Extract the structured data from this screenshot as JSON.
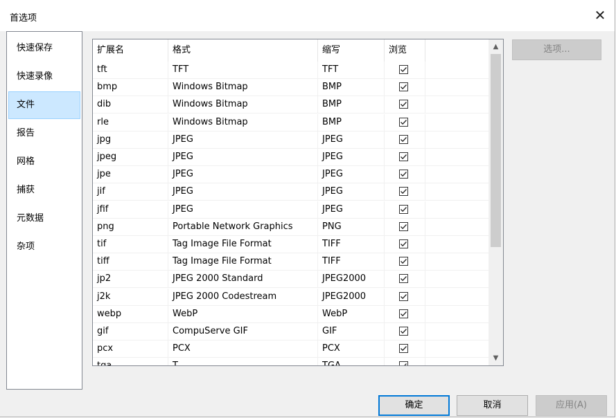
{
  "window": {
    "title": "首选项",
    "close_glyph": "✕"
  },
  "sidebar": {
    "items": [
      {
        "label": "快速保存"
      },
      {
        "label": "快速录像"
      },
      {
        "label": "文件",
        "selected": true
      },
      {
        "label": "报告"
      },
      {
        "label": "网格"
      },
      {
        "label": "捕获"
      },
      {
        "label": "元数据"
      },
      {
        "label": "杂项"
      }
    ]
  },
  "table": {
    "headers": {
      "ext": "扩展名",
      "format": "格式",
      "abbr": "缩写",
      "view": "浏览"
    },
    "rows": [
      {
        "ext": "tft",
        "format": "TFT",
        "abbr": "TFT",
        "checked": true
      },
      {
        "ext": "bmp",
        "format": "Windows Bitmap",
        "abbr": "BMP",
        "checked": true
      },
      {
        "ext": "dib",
        "format": "Windows Bitmap",
        "abbr": "BMP",
        "checked": true
      },
      {
        "ext": "rle",
        "format": "Windows Bitmap",
        "abbr": "BMP",
        "checked": true
      },
      {
        "ext": "jpg",
        "format": "JPEG",
        "abbr": "JPEG",
        "checked": true
      },
      {
        "ext": "jpeg",
        "format": "JPEG",
        "abbr": "JPEG",
        "checked": true
      },
      {
        "ext": "jpe",
        "format": "JPEG",
        "abbr": "JPEG",
        "checked": true
      },
      {
        "ext": "jif",
        "format": "JPEG",
        "abbr": "JPEG",
        "checked": true
      },
      {
        "ext": "jfif",
        "format": "JPEG",
        "abbr": "JPEG",
        "checked": true
      },
      {
        "ext": "png",
        "format": "Portable Network Graphics",
        "abbr": "PNG",
        "checked": true
      },
      {
        "ext": "tif",
        "format": "Tag Image File Format",
        "abbr": "TIFF",
        "checked": true
      },
      {
        "ext": "tiff",
        "format": "Tag Image File Format",
        "abbr": "TIFF",
        "checked": true
      },
      {
        "ext": "jp2",
        "format": "JPEG 2000 Standard",
        "abbr": "JPEG2000",
        "checked": true
      },
      {
        "ext": "j2k",
        "format": "JPEG 2000 Codestream",
        "abbr": "JPEG2000",
        "checked": true
      },
      {
        "ext": "webp",
        "format": "WebP",
        "abbr": "WebP",
        "checked": true
      },
      {
        "ext": "gif",
        "format": "CompuServe GIF",
        "abbr": "GIF",
        "checked": true
      },
      {
        "ext": "pcx",
        "format": "PCX",
        "abbr": "PCX",
        "checked": true
      },
      {
        "ext": "tga",
        "format": "T...",
        "abbr": "TGA",
        "checked": true
      }
    ]
  },
  "scrollbar": {
    "up_glyph": "▲",
    "down_glyph": "▼"
  },
  "buttons": {
    "options": "选项...",
    "ok": "确定",
    "cancel": "取消",
    "apply": "应用(A)"
  },
  "colors": {
    "accent": "#0078d7",
    "selection_bg": "#cce8ff",
    "selection_border": "#99d1ff",
    "disabled_text": "#838383"
  }
}
